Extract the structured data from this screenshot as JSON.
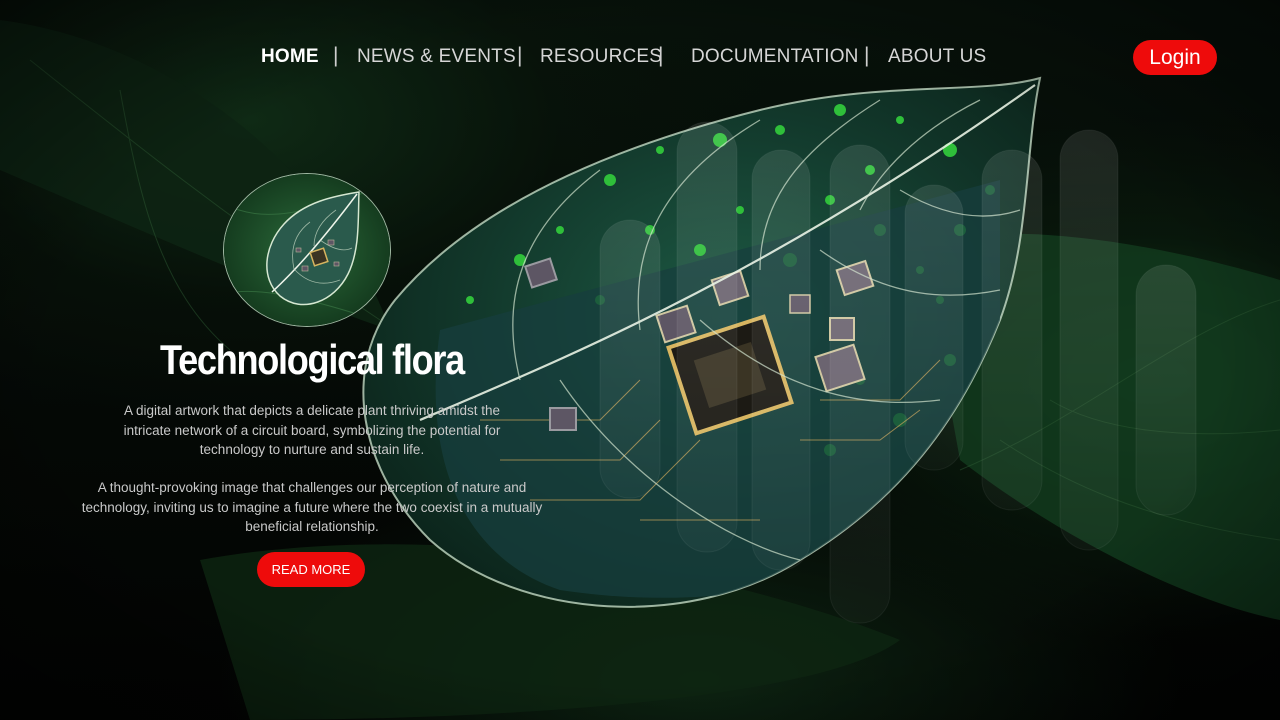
{
  "nav": {
    "items": [
      {
        "label": "HOME",
        "active": true
      },
      {
        "label": "NEWS & EVENTS",
        "active": false
      },
      {
        "label": "RESOURCES",
        "active": false
      },
      {
        "label": "DOCUMENTATION",
        "active": false
      },
      {
        "label": "ABOUT US",
        "active": false
      }
    ],
    "separator": "|",
    "login_label": "Login"
  },
  "hero": {
    "thumbnail_icon": "leaf-circuit-icon",
    "title": "Technological flora",
    "paragraph_1": "A digital artwork that depicts a delicate plant thriving amidst the intricate network of a circuit board, symbolizing the potential for technology to nurture and sustain life.",
    "paragraph_2": "A thought-provoking image that challenges our perception of nature and technology, inviting us to imagine a future where the two coexist in a mutually beneficial relationship.",
    "read_more_label": "READ MORE"
  },
  "colors": {
    "accent": "#ee0b0b",
    "text_primary": "#ffffff",
    "text_secondary": "#c9c9c9",
    "leaf_green": "#2fbf3a"
  }
}
